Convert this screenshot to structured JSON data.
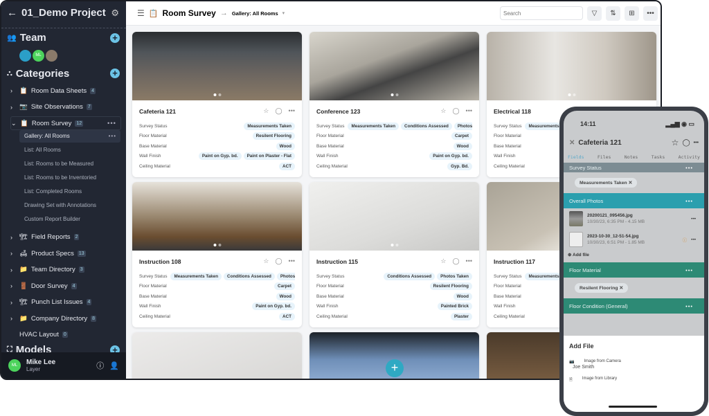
{
  "sidebar": {
    "project_title": "01_Demo Project",
    "team_label": "Team",
    "team_avatars": [
      {
        "initials": "",
        "color": "#2b9fc8"
      },
      {
        "initials": "ML",
        "color": "#4cd35c"
      },
      {
        "initials": "",
        "color": "#8a7a6a"
      }
    ],
    "categories_label": "Categories",
    "categories": [
      {
        "label": "Room Data Sheets",
        "icon": "📋",
        "count": "4",
        "expanded": false
      },
      {
        "label": "Site Observations",
        "icon": "📷",
        "count": "7",
        "expanded": false
      },
      {
        "label": "Room Survey",
        "icon": "📋",
        "count": "12",
        "expanded": true
      }
    ],
    "room_survey_views": [
      "Gallery: All Rooms",
      "List: All Rooms",
      "List: Rooms to be Measured",
      "List: Rooms to be Inventoried",
      "List: Completed Rooms",
      "Drawing Set with Annotations",
      "Custom Report Builder"
    ],
    "categories_after": [
      {
        "label": "Field Reports",
        "icon": "🏗",
        "count": "2"
      },
      {
        "label": "Product Specs",
        "icon": "🛋",
        "count": "13"
      },
      {
        "label": "Team Directory",
        "icon": "📁",
        "count": "3"
      },
      {
        "label": "Door Survey",
        "icon": "🚪",
        "count": "4"
      },
      {
        "label": "Punch List Issues",
        "icon": "🏗",
        "count": "4"
      },
      {
        "label": "Company Directory",
        "icon": "📁",
        "count": "8"
      }
    ],
    "hvac": {
      "label": "HVAC Layout",
      "count": "0"
    },
    "models_label": "Models",
    "user": {
      "initials": "ML",
      "name": "Mike Lee",
      "org": "Layer"
    }
  },
  "header": {
    "title": "Room Survey",
    "view": "Gallery: All Rooms",
    "search_placeholder": "Search"
  },
  "fields": [
    "Survey Status",
    "Floor Material",
    "Base Material",
    "Wall Finish",
    "Ceiling Material"
  ],
  "cards": [
    {
      "title": "Cafeteria 121",
      "photo": "linear-gradient(180deg,#2a2d30 0%,#50555a 30%,#6b6560 60%,#8a7a66 100%)",
      "values": [
        [
          "Measurements Taken"
        ],
        [
          "Resilent Flooring"
        ],
        [
          "Wood"
        ],
        [
          "Paint on Gyp. bd.",
          "Paint on Plaster - Flat"
        ],
        [
          "ACT"
        ]
      ],
      "align": "right"
    },
    {
      "title": "Conference 123",
      "photo": "linear-gradient(160deg,#d8d5cc 0%,#a9a59c 40%,#444 60%,#b8b3a8 100%)",
      "values": [
        [
          "Measurements Taken",
          "Conditions Assessed",
          "Photos Taken"
        ],
        [
          "Carpet"
        ],
        [
          "Wood"
        ],
        [
          "Paint on Gyp. bd."
        ],
        [
          "Gyp. Bd."
        ]
      ],
      "align": "left"
    },
    {
      "title": "Electrical 118",
      "photo": "linear-gradient(90deg,#b8b2a8 0%,#e8e6e2 40%,#cfc9c0 70%,#9e968a 100%)",
      "values": [
        [
          "Measurements Taken"
        ],
        [],
        [],
        [],
        []
      ],
      "align": "left"
    },
    {
      "title": "Instruction 108",
      "photo": "linear-gradient(180deg,#e6e2da 0%,#9a8870 50%,#6a4d30 80%,#3a3a3a 100%)",
      "values": [
        [
          "Measurements Taken",
          "Conditions Assessed",
          "Photos Taken"
        ],
        [
          "Carpet"
        ],
        [
          "Wood"
        ],
        [
          "Paint on Gyp. bd."
        ],
        [
          "ACT"
        ]
      ],
      "align": "left"
    },
    {
      "title": "Instruction 115",
      "photo": "linear-gradient(160deg,#f0f0ee 0%,#dcdcda 60%,#c8c8c6 100%)",
      "values": [
        [
          "Conditions Assessed",
          "Photos Taken"
        ],
        [
          "Resilent Flooring"
        ],
        [
          "Wood"
        ],
        [
          "Painted Brick"
        ],
        [
          "Plaster"
        ]
      ],
      "align": "right"
    },
    {
      "title": "Instruction 117",
      "photo": "linear-gradient(150deg,#a9a396 0%,#c9c2b5 50%,#e9e6df 70%,#7d8088 100%)",
      "values": [
        [
          "Measurements Taken"
        ],
        [],
        [],
        [],
        []
      ],
      "align": "left"
    },
    {
      "title": "",
      "photo": "linear-gradient(160deg,#ecebea,#d5d4d2)",
      "values": [],
      "align": "left"
    },
    {
      "title": "",
      "photo": "linear-gradient(180deg,#1d2228 0%,#6f8fb8 40%,#a9c4e6 100%)",
      "values": [],
      "align": "left"
    },
    {
      "title": "",
      "photo": "linear-gradient(180deg,#4a3a2a,#8a6a4a)",
      "values": [],
      "align": "left"
    }
  ],
  "phone": {
    "time": "14:11",
    "title": "Cafeteria 121",
    "tabs": [
      "Fields",
      "Files",
      "Notes",
      "Tasks",
      "Activity"
    ],
    "survey_status_label": "Survey Status",
    "survey_status_chip": "Measurements Taken",
    "overall_photos_label": "Overall Photos",
    "files": [
      {
        "name": "20200121_095456.jpg",
        "meta": "10/30/23, 6:35 PM - 4.15 MB",
        "warning": false
      },
      {
        "name": "2023-10-30_12-51-54.jpg",
        "meta": "10/30/23, 6:51 PM - 1.85 MB",
        "warning": true
      }
    ],
    "add_file": "Add file",
    "floor_material_label": "Floor Material",
    "floor_material_chip": "Resilent Flooring",
    "floor_condition_label": "Floor Condition (General)",
    "sheet_title": "Add File",
    "sheet_options": [
      "Image from Camera",
      "Image from Library"
    ],
    "sheet_overlay_name": "Joe Smith"
  },
  "colors": {
    "accent": "#2fa9c3",
    "sidebar_bg": "#222733",
    "teal_bar": "#2b9fae",
    "green_bar": "#2d8a75"
  }
}
